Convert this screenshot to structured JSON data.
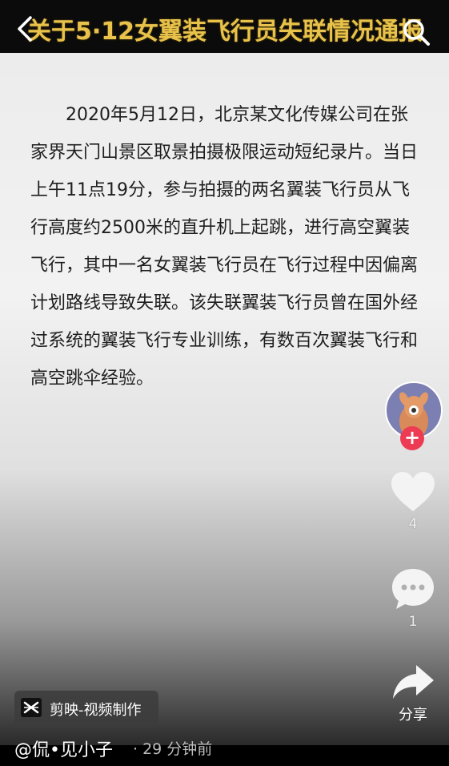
{
  "header": {
    "title": "关于5·12女翼装飞行员失联情况通报",
    "title_color": "#e8c24a"
  },
  "article": {
    "paragraph": "2020年5月12日，北京某文化传媒公司在张家界天门山景区取景拍摄极限运动短纪录片。当日上午11点19分，参与拍摄的两名翼装飞行员从飞行高度约2500米的直升机上起跳，进行高空翼装飞行，其中一名女翼装飞行员在飞行过程中因偏离计划路线导致失联。该失联翼装飞行员曾在国外经过系统的翼装飞行专业训练，有数百次翼装飞行和高空跳伞经验。"
  },
  "sidebar": {
    "follow_symbol": "+",
    "like_count": "4",
    "comment_count": "1",
    "share_label": "分享"
  },
  "capcut": {
    "label": "剪映-视频制作"
  },
  "footer": {
    "author": "@侃•见小子",
    "time": "· 29 分钟前"
  },
  "colors": {
    "follow_red": "#ee3b54",
    "avatar_bg": "#7c7fb2"
  },
  "icons": [
    "back-icon",
    "search-icon",
    "heart-icon",
    "comment-icon",
    "share-icon",
    "capcut-logo-icon"
  ]
}
